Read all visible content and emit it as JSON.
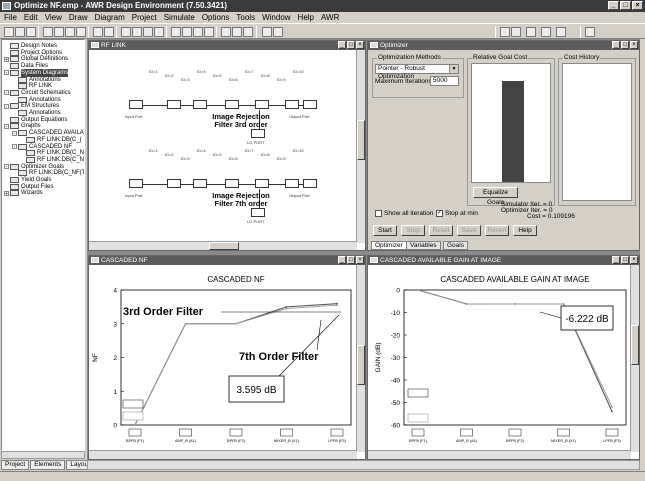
{
  "window": {
    "title": "Optimize NF.emp - AWR Design Environment (7.50.3421)"
  },
  "menu": [
    "File",
    "Edit",
    "View",
    "Draw",
    "Diagram",
    "Project",
    "Simulate",
    "Options",
    "Tools",
    "Window",
    "Help",
    "AWR"
  ],
  "tree": [
    {
      "label": "Design Notes",
      "depth": 0,
      "exp": ""
    },
    {
      "label": "Project Options",
      "depth": 0,
      "exp": ""
    },
    {
      "label": "Global Definitions",
      "depth": 0,
      "exp": "+"
    },
    {
      "label": "Data Files",
      "depth": 0,
      "exp": ""
    },
    {
      "label": "System Diagrams",
      "depth": 0,
      "exp": "-",
      "selected": true
    },
    {
      "label": "Annotations",
      "depth": 1,
      "exp": ""
    },
    {
      "label": "RF LINK",
      "depth": 1,
      "exp": ""
    },
    {
      "label": "Circuit Schematics",
      "depth": 0,
      "exp": "-"
    },
    {
      "label": "Annotations",
      "depth": 1,
      "exp": ""
    },
    {
      "label": "EM Structures",
      "depth": 0,
      "exp": "-"
    },
    {
      "label": "Annotations",
      "depth": 1,
      "exp": ""
    },
    {
      "label": "Output Equations",
      "depth": 0,
      "exp": ""
    },
    {
      "label": "Graphs",
      "depth": 0,
      "exp": "-"
    },
    {
      "label": "CASCADED AVAILAB",
      "depth": 1,
      "exp": "-"
    },
    {
      "label": "RF LINK:DB(C_(",
      "depth": 2,
      "exp": ""
    },
    {
      "label": "CASCADED NF",
      "depth": 1,
      "exp": "-"
    },
    {
      "label": "RF LINK:DB(C_N",
      "depth": 2,
      "exp": ""
    },
    {
      "label": "RF LINK:DB(C_N",
      "depth": 2,
      "exp": ""
    },
    {
      "label": "Optimizer Goals",
      "depth": 0,
      "exp": "-"
    },
    {
      "label": "RF LINK:DB(C_NF(TI",
      "depth": 1,
      "exp": ""
    },
    {
      "label": "Yield Goals",
      "depth": 0,
      "exp": ""
    },
    {
      "label": "Output Files",
      "depth": 0,
      "exp": ""
    },
    {
      "label": "Wizards",
      "depth": 0,
      "exp": "+"
    }
  ],
  "bottom_tabs": [
    "Project",
    "Elements",
    "Layout"
  ],
  "rf_link": {
    "title": "RF LINK",
    "label_top": "Image Rejection\nFilter 3rd order",
    "label_bottom": "Image Rejection\nFilter 7th order",
    "port_in": "Input Port",
    "port_out": "Output Port",
    "lo_label": "LO PORT"
  },
  "optimizer": {
    "title": "Optimizer",
    "methods_label": "Optimization Methods",
    "method_value": "Pointer - Robust Optimization",
    "max_iter_label": "Maximum Iterations",
    "max_iter_value": "5000",
    "rel_cost_label": "Relative Goal Cost",
    "cost_history_label": "Cost History",
    "equalize_label": "Equalize Goals",
    "sim_iter": "Simulator Iter. = 0",
    "opt_iter": "Optimizer Iter. = 0",
    "cost": "Cost = 0.109196",
    "show_all_label": "Show all iteration",
    "stop_min_label": "Stop at min",
    "buttons": [
      "Start",
      "Stop",
      "Reset",
      "Save",
      "Revert",
      "Help"
    ],
    "tabs": [
      "Optimizer",
      "Variables",
      "Goals"
    ],
    "relative_cost": 0.86
  },
  "nf_window": {
    "caption": "CASCADED NF",
    "filter3_label": "3rd Order Filter",
    "filter7_label": "7th Order Filter",
    "callout": "3.595 dB"
  },
  "gain_window": {
    "caption": "CASCADED AVAILABLE GAIN AT IMAGE",
    "callout": "-6.222 dB"
  },
  "chart_data": [
    {
      "type": "line",
      "title": "CASCADED NF",
      "xlabel": "",
      "ylabel": "NF",
      "ylim": [
        0,
        4
      ],
      "yticks": [
        0,
        1,
        2,
        3,
        4
      ],
      "categories": [
        "BPFB (F1)",
        "AMP_B (A1)",
        "BPFB (F2)",
        "MIXER_B (X1)",
        "LPFB (F3)"
      ],
      "series": [
        {
          "values": [
            0,
            3.0,
            3.0,
            3.5,
            3.595
          ]
        },
        {
          "values": [
            0,
            3.0,
            3.0,
            3.45,
            3.55
          ]
        }
      ],
      "grid": false
    },
    {
      "type": "line",
      "title": "CASCADED AVAILABLE GAIN AT IMAGE",
      "xlabel": "",
      "ylabel": "GAIN (dB)",
      "ylim": [
        -60,
        0
      ],
      "yticks": [
        0,
        -10,
        -20,
        -30,
        -40,
        -50,
        -60
      ],
      "categories": [
        "BPFB (F1)",
        "AMP_B (A1)",
        "BPFB (F2)",
        "MIXER_B (X1)",
        "LPFB (F3)"
      ],
      "series": [
        {
          "values": [
            0,
            -6.2,
            -6.222,
            -6.222,
            -54
          ]
        },
        {
          "values": [
            0,
            -6.2,
            -6.222,
            -6.222,
            -52
          ]
        }
      ],
      "grid": false
    }
  ]
}
